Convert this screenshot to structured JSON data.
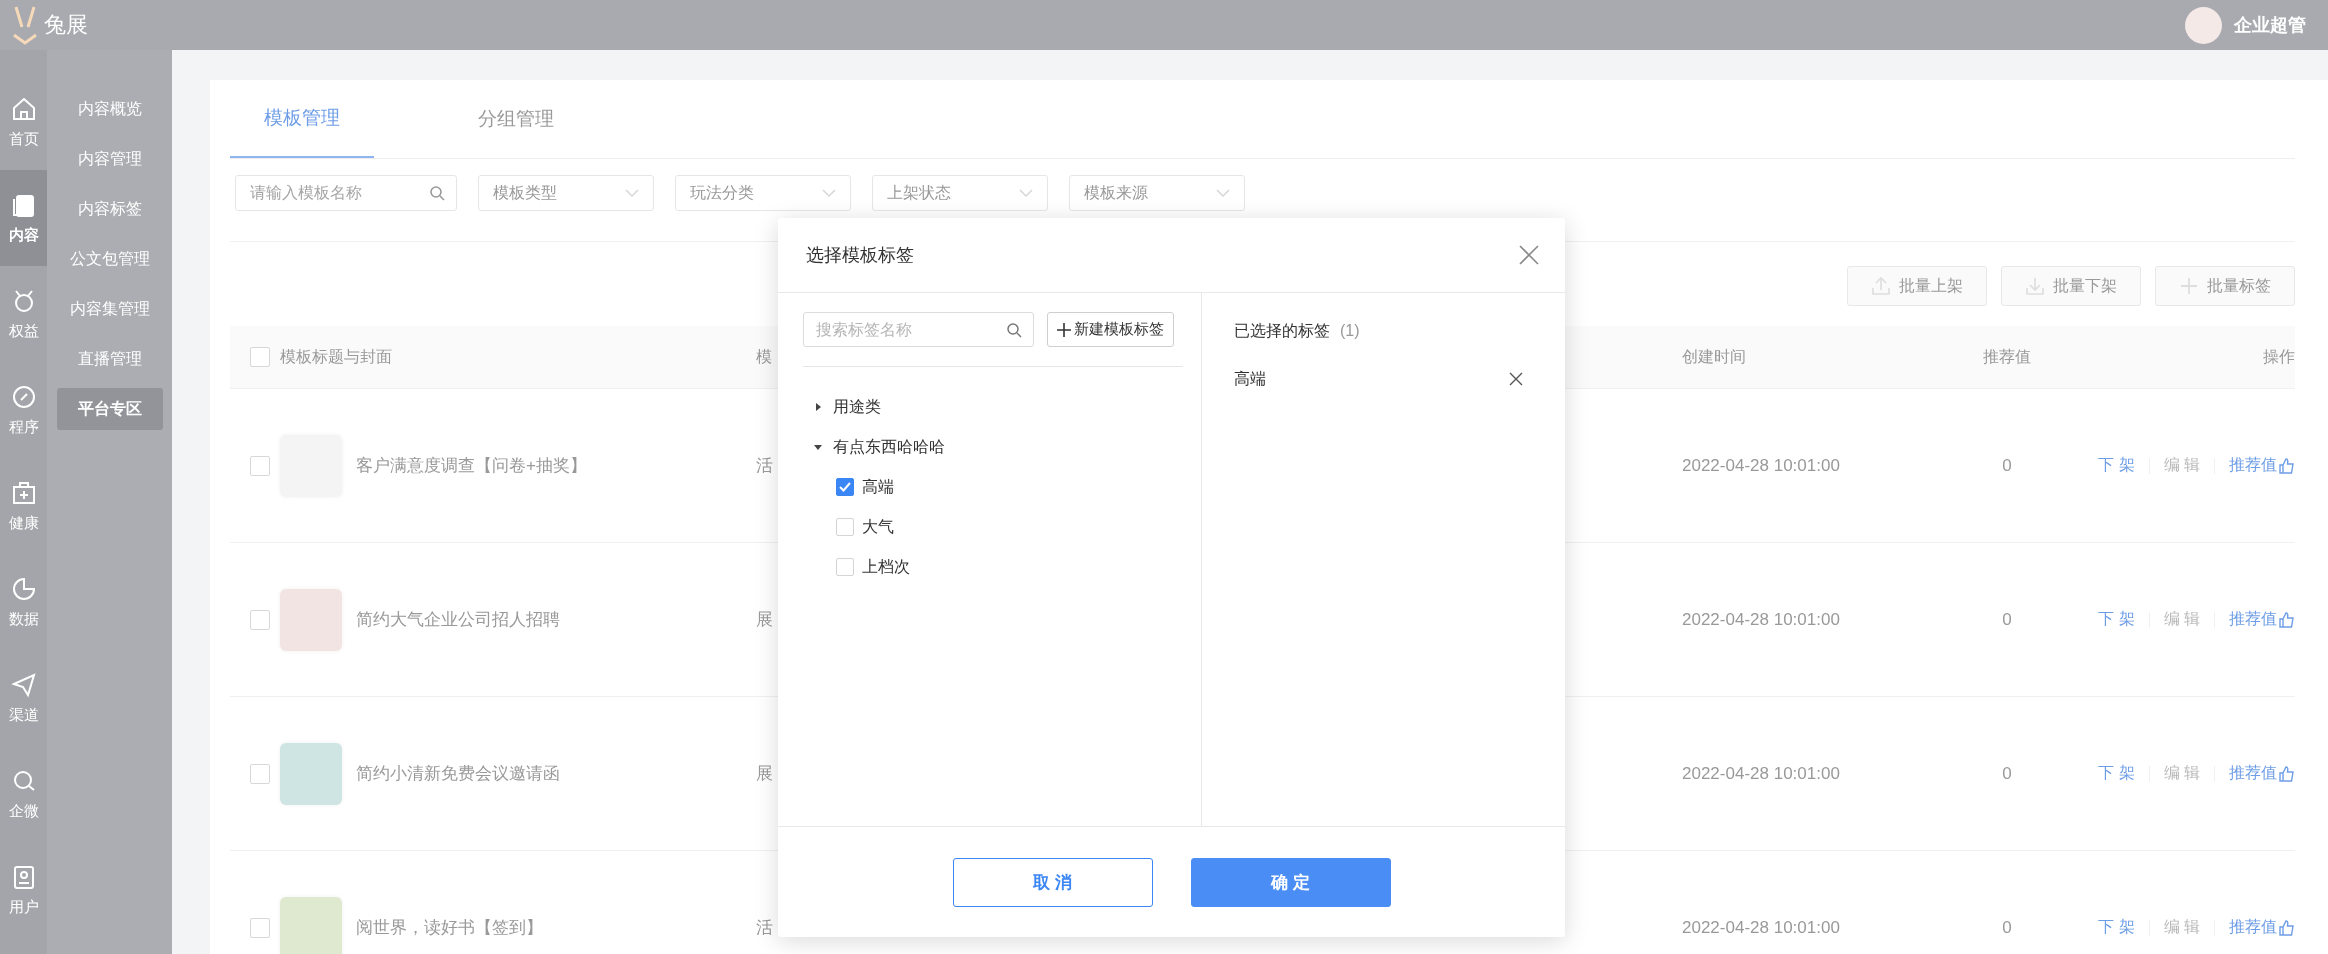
{
  "header": {
    "logo_text": "兔展",
    "user": "企业超管"
  },
  "nav": [
    {
      "label": "首页",
      "selected": false
    },
    {
      "label": "内容",
      "selected": true
    },
    {
      "label": "权益",
      "selected": false
    },
    {
      "label": "程序",
      "selected": false
    },
    {
      "label": "健康",
      "selected": false
    },
    {
      "label": "数据",
      "selected": false
    },
    {
      "label": "渠道",
      "selected": false
    },
    {
      "label": "企微",
      "selected": false
    },
    {
      "label": "用户",
      "selected": false
    }
  ],
  "subnav": [
    {
      "label": "内容概览",
      "selected": false
    },
    {
      "label": "内容管理",
      "selected": false
    },
    {
      "label": "内容标签",
      "selected": false
    },
    {
      "label": "公文包管理",
      "selected": false
    },
    {
      "label": "内容集管理",
      "selected": false
    },
    {
      "label": "直播管理",
      "selected": false
    },
    {
      "label": "平台专区",
      "selected": true
    }
  ],
  "tabs": [
    {
      "label": "模板管理",
      "selected": true
    },
    {
      "label": "分组管理",
      "selected": false
    }
  ],
  "filters": {
    "search_placeholder": "请输入模板名称",
    "selects": [
      "模板类型",
      "玩法分类",
      "上架状态",
      "模板来源"
    ]
  },
  "batch_buttons": [
    {
      "label": "批量上架",
      "kind": "upload"
    },
    {
      "label": "批量下架",
      "kind": "download"
    },
    {
      "label": "批量标签",
      "kind": "plus"
    }
  ],
  "table": {
    "columns": [
      "模板标题与封面",
      "模",
      "创建时间",
      "推荐值",
      "操作"
    ],
    "all_checked": false,
    "rows": [
      {
        "checked": false,
        "title": "客户满意度调查【问卷+抽奖】",
        "column_2": "活",
        "created": "2022-04-28 10:01:00",
        "score": "0",
        "color": "#f4f4f4",
        "actions": [
          {
            "label": "下 架",
            "kind": "text",
            "disabled": false
          },
          {
            "label": "编 辑",
            "kind": "text",
            "disabled": true
          },
          {
            "label": "推荐值",
            "kind": "like",
            "disabled": false
          }
        ]
      },
      {
        "checked": false,
        "title": "简约大气企业公司招人招聘",
        "column_2": "展",
        "created": "2022-04-28 10:01:00",
        "score": "0",
        "color": "#f3e4e4",
        "actions": [
          {
            "label": "下 架",
            "kind": "text",
            "disabled": false
          },
          {
            "label": "编 辑",
            "kind": "text",
            "disabled": true
          },
          {
            "label": "推荐值",
            "kind": "like",
            "disabled": false
          }
        ]
      },
      {
        "checked": false,
        "title": "简约小清新免费会议邀请函",
        "column_2": "展",
        "created": "2022-04-28 10:01:00",
        "score": "0",
        "color": "#cfe5e3",
        "actions": [
          {
            "label": "下 架",
            "kind": "text",
            "disabled": false
          },
          {
            "label": "编 辑",
            "kind": "text",
            "disabled": true
          },
          {
            "label": "推荐值",
            "kind": "like",
            "disabled": false
          }
        ]
      },
      {
        "checked": false,
        "title": "阅世界，读好书【签到】",
        "column_2": "活",
        "created": "2022-04-28 10:01:00",
        "score": "0",
        "color": "#dfe9cf",
        "actions": [
          {
            "label": "下 架",
            "kind": "text",
            "disabled": false
          },
          {
            "label": "编 辑",
            "kind": "text",
            "disabled": true
          },
          {
            "label": "推荐值",
            "kind": "like",
            "disabled": false
          }
        ]
      }
    ]
  },
  "dialog": {
    "title": "选择模板标签",
    "search_placeholder": "搜索标签名称",
    "new_button": "新建模板标签",
    "tree": [
      {
        "label": "用途类",
        "expanded": false
      },
      {
        "label": "有点东西哈哈哈",
        "expanded": true,
        "children": [
          {
            "label": "高端",
            "checked": true
          },
          {
            "label": "大气",
            "checked": false
          },
          {
            "label": "上档次",
            "checked": false
          }
        ]
      }
    ],
    "selected_title": "已选择的标签",
    "selected_count": "(1)",
    "selected_tags": [
      "高端"
    ],
    "cancel": "取 消",
    "ok": "确 定"
  }
}
